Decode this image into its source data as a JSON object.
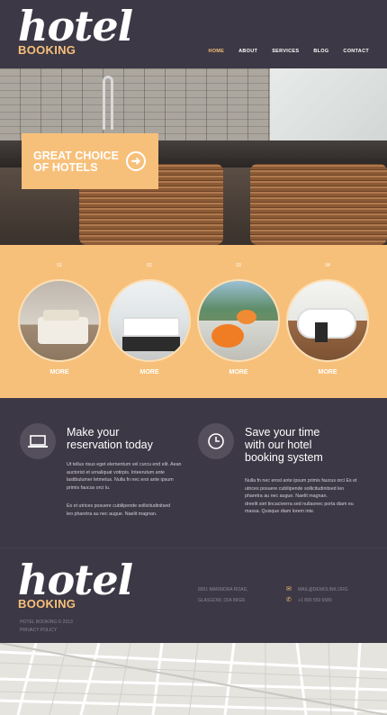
{
  "header": {
    "logo_script": "hotel",
    "logo_booking": "BOOKING",
    "nav": [
      "HOME",
      "ABOUT",
      "SERVICES",
      "BLOG",
      "CONTACT"
    ]
  },
  "hero": {
    "cta_line1": "GREAT CHOICE",
    "cta_line2": "OF HOTELS"
  },
  "services": [
    {
      "num": "01",
      "label": "MORE"
    },
    {
      "num": "02",
      "label": "MORE"
    },
    {
      "num": "03",
      "label": "MORE"
    },
    {
      "num": "04",
      "label": "MORE"
    }
  ],
  "features": {
    "left": {
      "title1": "Make your",
      "title2": "reservation today",
      "para1": [
        "Ut tellus risus eget elementum vel curcu end elit. Aean",
        "auctorist et urnaliquat votirpis. Inteerutum ante",
        "lastibulumer letmetus. Nulla fn nec eroi ante ipsum",
        "primis faucus orci lu."
      ],
      "para2": [
        "Es et utrices posuere cubilipende sollicitudinitsed",
        "leo pharetra au nec augue. Naelit magnan."
      ]
    },
    "right": {
      "title1": "Save your time",
      "title2": "with our hotel",
      "title3": "booking system",
      "para1": [
        "Nulla fn nec erosl ante ipsum primis faucus orci Es et",
        "utrices posuere cubilipende sollicitudinitsed leo",
        "pharetra au nec augue. Naelit magnan.",
        "dreelit siet tincaciverra sed nullaonec porta diam eu",
        "massa. Quisque diam lorem inte."
      ]
    }
  },
  "footer": {
    "logo_script": "hotel",
    "logo_booking": "BOOKING",
    "copyright": "HOTEL BOOKING © 2013",
    "privacy": "PRIVACY POLICY",
    "address1": "8901 MARMORA ROAD,",
    "address2": "GLASGOW, D04 89GR.",
    "email": "MAIL@DEMOLINK.ORG",
    "phone": "+1 800 559 6580"
  },
  "colors": {
    "dark": "#3d3845",
    "accent": "#f7c07a"
  }
}
